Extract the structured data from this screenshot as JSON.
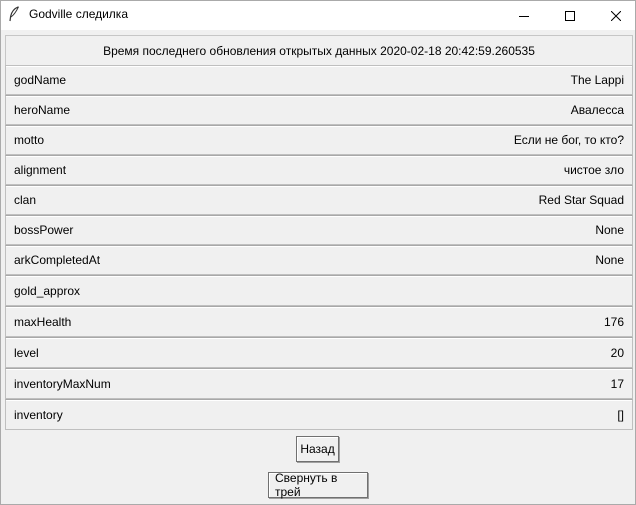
{
  "window": {
    "title": "Godville следилка",
    "app_icon": "feather-icon"
  },
  "header": {
    "last_update_text": "Время последнего обновления открытых данных 2020-02-18 20:42:59.260535"
  },
  "rows": [
    {
      "key": "godName",
      "value": "The Lappi"
    },
    {
      "key": "heroName",
      "value": "Авалесса"
    },
    {
      "key": "motto",
      "value": "Если не бог, то кто?"
    },
    {
      "key": "alignment",
      "value": "чистое зло"
    },
    {
      "key": "clan",
      "value": "Red Star Squad"
    },
    {
      "key": "bossPower",
      "value": "None"
    },
    {
      "key": "arkCompletedAt",
      "value": "None"
    },
    {
      "key": "gold_approx",
      "value": ""
    },
    {
      "key": "maxHealth",
      "value": "176"
    },
    {
      "key": "level",
      "value": "20"
    },
    {
      "key": "inventoryMaxNum",
      "value": "17"
    },
    {
      "key": "inventory",
      "value": "[]"
    }
  ],
  "buttons": {
    "back_label": "Назад",
    "tray_label": "Свернуть в трей"
  }
}
